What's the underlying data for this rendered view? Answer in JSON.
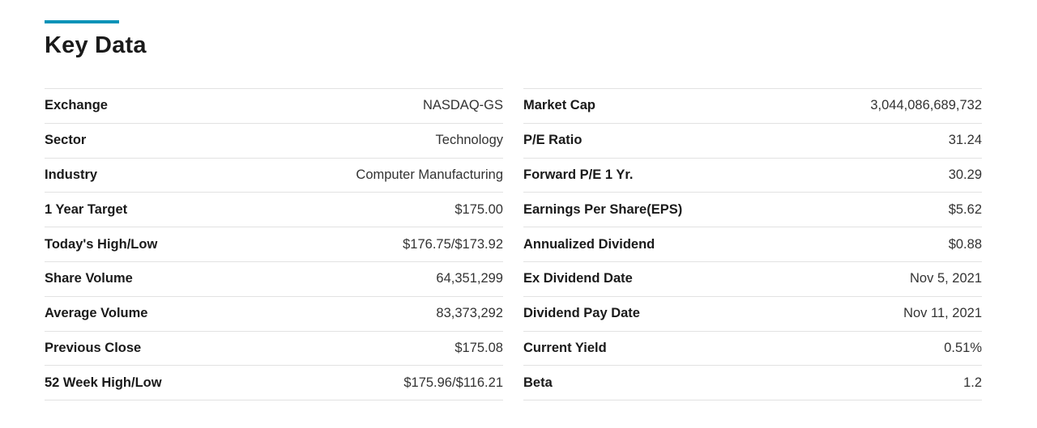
{
  "title": "Key Data",
  "accent_color": "#0a93b8",
  "left_table": [
    {
      "label": "Exchange",
      "value": "NASDAQ-GS"
    },
    {
      "label": "Sector",
      "value": "Technology"
    },
    {
      "label": "Industry",
      "value": "Computer Manufacturing"
    },
    {
      "label": "1 Year Target",
      "value": "$175.00"
    },
    {
      "label": "Today's High/Low",
      "value": "$176.75/$173.92"
    },
    {
      "label": "Share Volume",
      "value": "64,351,299"
    },
    {
      "label": "Average Volume",
      "value": "83,373,292"
    },
    {
      "label": "Previous Close",
      "value": "$175.08"
    },
    {
      "label": "52 Week High/Low",
      "value": "$175.96/$116.21"
    }
  ],
  "right_table": [
    {
      "label": "Market Cap",
      "value": "3,044,086,689,732"
    },
    {
      "label": "P/E Ratio",
      "value": "31.24"
    },
    {
      "label": "Forward P/E 1 Yr.",
      "value": "30.29"
    },
    {
      "label": "Earnings Per Share(EPS)",
      "value": "$5.62"
    },
    {
      "label": "Annualized Dividend",
      "value": "$0.88"
    },
    {
      "label": "Ex Dividend Date",
      "value": "Nov 5, 2021"
    },
    {
      "label": "Dividend Pay Date",
      "value": "Nov 11, 2021"
    },
    {
      "label": "Current Yield",
      "value": "0.51%"
    },
    {
      "label": "Beta",
      "value": "1.2"
    }
  ]
}
